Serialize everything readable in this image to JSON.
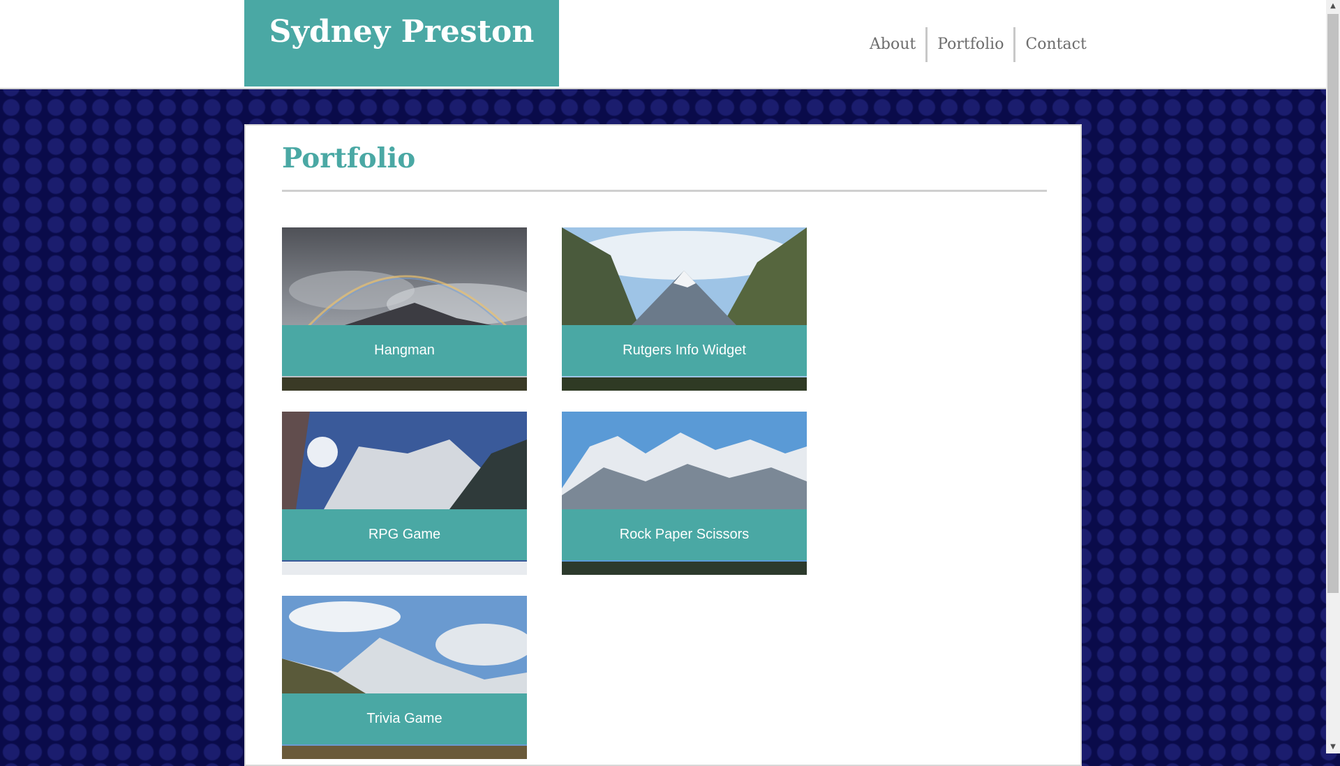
{
  "header": {
    "brand": "Sydney Preston",
    "nav": [
      "About",
      "Portfolio",
      "Contact"
    ]
  },
  "main": {
    "title": "Portfolio",
    "projects": [
      {
        "label": "Hangman",
        "image": "rainbow-over-mountain"
      },
      {
        "label": "Rutgers Info Widget",
        "image": "snowy-peak-valley"
      },
      {
        "label": "RPG Game",
        "image": "sunlit-snowy-forest"
      },
      {
        "label": "Rock Paper Scissors",
        "image": "snowy-mountain-range"
      },
      {
        "label": "Trivia Game",
        "image": "mountain-slope-clouds"
      }
    ]
  },
  "colors": {
    "accent": "#4aa8a4",
    "background": "#0a0b4a",
    "nav_text": "#6d6d6d"
  },
  "icons": {
    "scroll_up": "scroll-up-arrow-icon",
    "scroll_down": "scroll-down-arrow-icon"
  }
}
